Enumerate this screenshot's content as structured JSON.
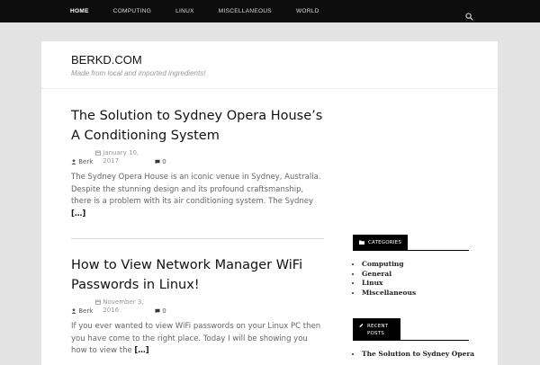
{
  "nav": {
    "items": [
      "HOME",
      "COMPUTING",
      "LINUX",
      "MISCELLANEOUS",
      "WORLD"
    ]
  },
  "site": {
    "title": "BERKD.COM",
    "description": "Made from local and imported ingredients!"
  },
  "posts": [
    {
      "title": "The Solution to Sydney Opera House’s A Conditioning System",
      "date": "January 10, 2017",
      "author": "Berk",
      "comments": "0",
      "excerpt": "The Sydney Opera House is an iconic venue in Sydney, Australia. Despite the stunning design and its profound craftsmanship, there is a problem with its air conditioning system. The Sydney",
      "more": "[…]"
    },
    {
      "title": "How to View Network Manager WiFi Passwords in Linux!",
      "date": "November 3, 2016",
      "author": "Berk",
      "comments": "0",
      "excerpt": "If you ever wanted to view WiFi passwords on your Linux PC then you have come to the right place. Today I will be showing you how to view the",
      "more": "[…]"
    }
  ],
  "sidebar": {
    "categories_title": "CATEGORIES",
    "categories": [
      "Computing",
      "General",
      "Linux",
      "Miscellaneous"
    ],
    "recent_title": "RECENT POSTS",
    "recent": [
      "The Solution to Sydney Opera"
    ]
  },
  "colors": {
    "topbar": "#0d0d0d",
    "background": "#e3e3e3",
    "widget_head": "#000000"
  }
}
